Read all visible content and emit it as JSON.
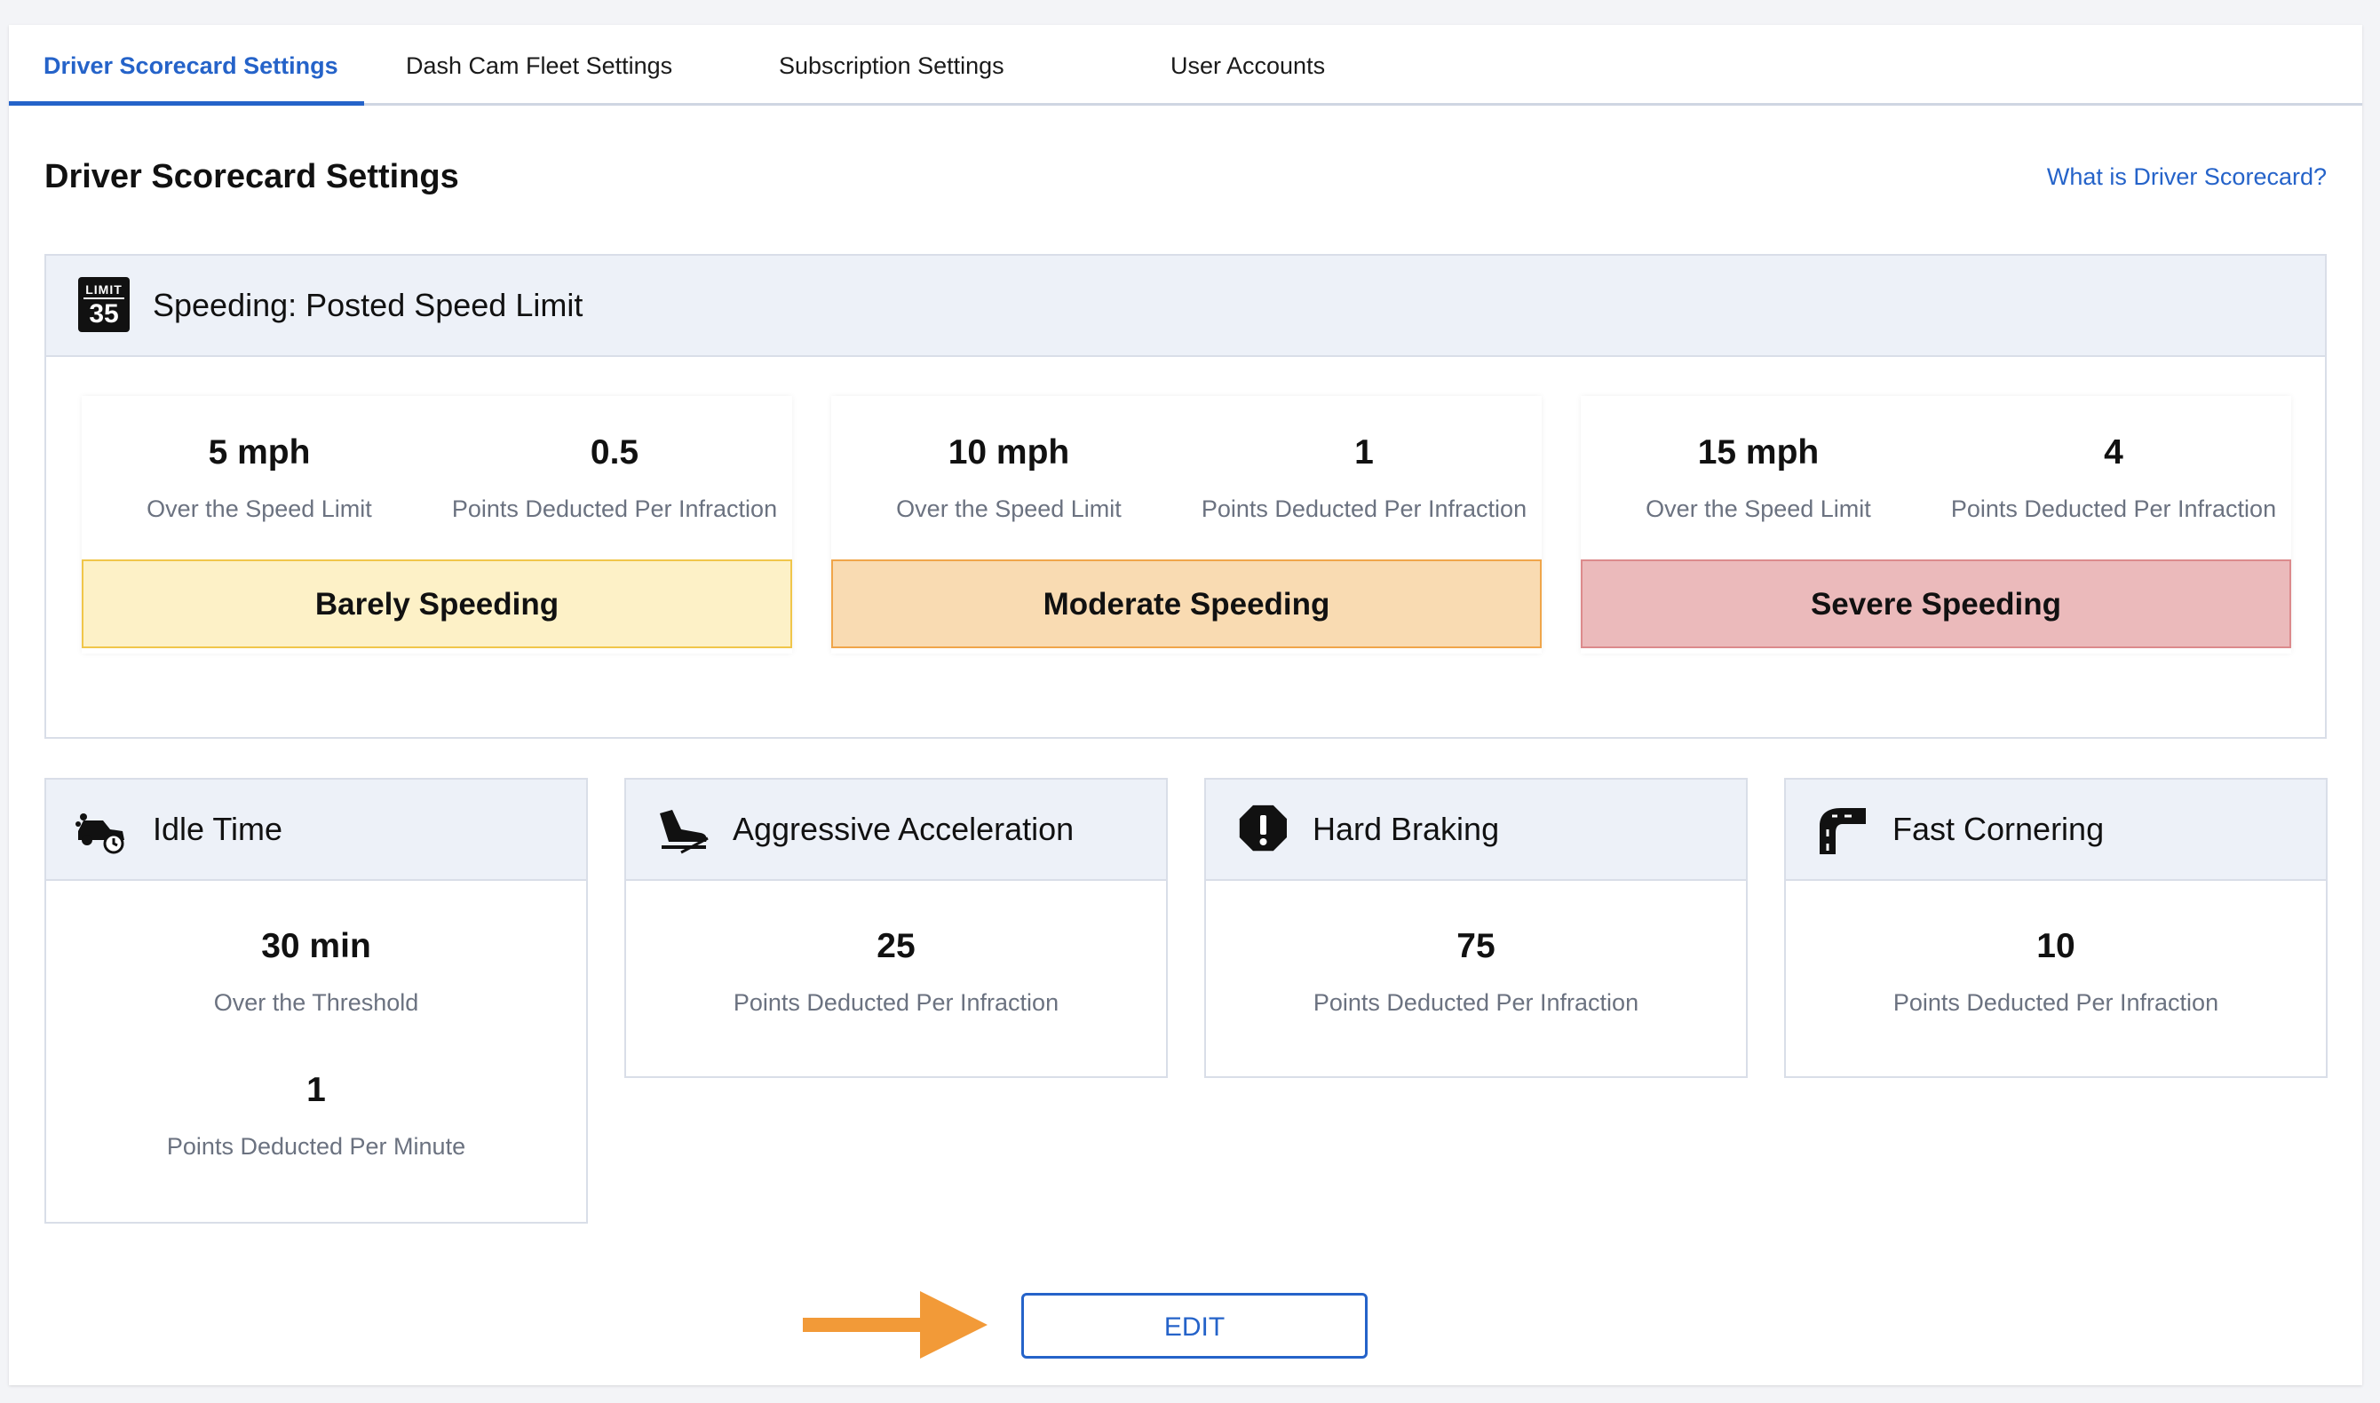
{
  "tabs": [
    {
      "label": "Driver Scorecard Settings",
      "active": true
    },
    {
      "label": "Dash Cam Fleet Settings",
      "active": false
    },
    {
      "label": "Subscription Settings",
      "active": false
    },
    {
      "label": "User Accounts",
      "active": false
    }
  ],
  "header": {
    "title": "Driver Scorecard Settings",
    "help_link": "What is Driver Scorecard?"
  },
  "speeding": {
    "title": "Speeding: Posted Speed Limit",
    "icon": {
      "top": "LIMIT",
      "number": "35"
    },
    "tiers": [
      {
        "speed": "5 mph",
        "speed_label": "Over the Speed Limit",
        "points": "0.5",
        "points_label": "Points Deducted Per Infraction",
        "name": "Barely Speeding",
        "color": "#fdf1c7",
        "border": "#f0c64a"
      },
      {
        "speed": "10 mph",
        "speed_label": "Over the Speed Limit",
        "points": "1",
        "points_label": "Points Deducted Per Infraction",
        "name": "Moderate Speeding",
        "color": "#f9dbb2",
        "border": "#f0a54a"
      },
      {
        "speed": "15 mph",
        "speed_label": "Over the Speed Limit",
        "points": "4",
        "points_label": "Points Deducted Per Infraction",
        "name": "Severe Speeding",
        "color": "#ebbabb",
        "border": "#dc8a8c"
      }
    ]
  },
  "idle": {
    "title": "Idle Time",
    "threshold": "30 min",
    "threshold_label": "Over the Threshold",
    "points": "1",
    "points_label": "Points Deducted Per Minute"
  },
  "acceleration": {
    "title": "Aggressive Acceleration",
    "points": "25",
    "points_label": "Points Deducted Per Infraction"
  },
  "braking": {
    "title": "Hard Braking",
    "points": "75",
    "points_label": "Points Deducted Per Infraction"
  },
  "cornering": {
    "title": "Fast Cornering",
    "points": "10",
    "points_label": "Points Deducted Per Infraction"
  },
  "actions": {
    "edit_label": "EDIT",
    "arrow_color": "#f29a38"
  }
}
